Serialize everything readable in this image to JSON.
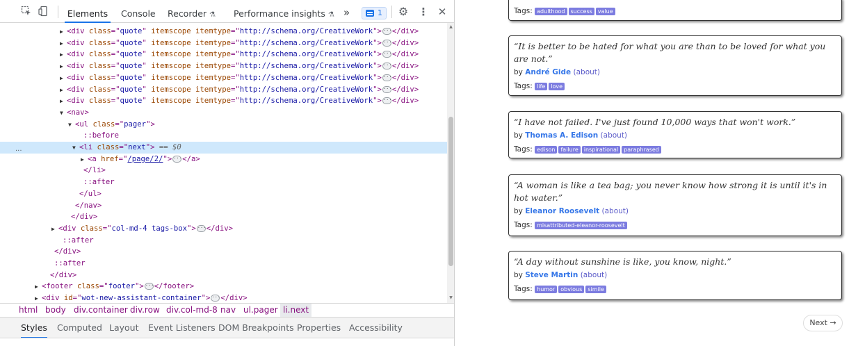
{
  "devtools": {
    "toolbar": {
      "tabs": [
        {
          "label": "Elements",
          "active": true
        },
        {
          "label": "Console",
          "active": false
        },
        {
          "label": "Recorder",
          "active": false
        },
        {
          "label": "Performance insights",
          "active": false
        }
      ],
      "more_tabs": "»",
      "issues_count": "1",
      "icons": [
        "inspect-icon",
        "device-toggle-icon",
        "flask-icon",
        "chevron-double-right-icon",
        "issues-icon",
        "gear-icon",
        "kebab-menu-icon",
        "close-icon"
      ]
    },
    "dom_lines": [
      {
        "indent": 0,
        "arrow": "▶",
        "parts": [
          [
            "tag",
            "<div "
          ],
          [
            "attr",
            "class"
          ],
          [
            "tag",
            "=\""
          ],
          [
            "val",
            "quote"
          ],
          [
            "tag",
            "\" "
          ],
          [
            "attr",
            "itemscope itemtype"
          ],
          [
            "tag",
            "=\""
          ],
          [
            "val",
            "http://schema.org/CreativeWork"
          ],
          [
            "tag",
            "\">"
          ],
          [
            "ell",
            ""
          ],
          [
            "tag",
            "</div>"
          ]
        ]
      },
      {
        "indent": 0,
        "arrow": "▶",
        "parts": [
          [
            "tag",
            "<div "
          ],
          [
            "attr",
            "class"
          ],
          [
            "tag",
            "=\""
          ],
          [
            "val",
            "quote"
          ],
          [
            "tag",
            "\" "
          ],
          [
            "attr",
            "itemscope itemtype"
          ],
          [
            "tag",
            "=\""
          ],
          [
            "val",
            "http://schema.org/CreativeWork"
          ],
          [
            "tag",
            "\">"
          ],
          [
            "ell",
            ""
          ],
          [
            "tag",
            "</div>"
          ]
        ]
      },
      {
        "indent": 0,
        "arrow": "▶",
        "parts": [
          [
            "tag",
            "<div "
          ],
          [
            "attr",
            "class"
          ],
          [
            "tag",
            "=\""
          ],
          [
            "val",
            "quote"
          ],
          [
            "tag",
            "\" "
          ],
          [
            "attr",
            "itemscope itemtype"
          ],
          [
            "tag",
            "=\""
          ],
          [
            "val",
            "http://schema.org/CreativeWork"
          ],
          [
            "tag",
            "\">"
          ],
          [
            "ell",
            ""
          ],
          [
            "tag",
            "</div>"
          ]
        ]
      },
      {
        "indent": 0,
        "arrow": "▶",
        "parts": [
          [
            "tag",
            "<div "
          ],
          [
            "attr",
            "class"
          ],
          [
            "tag",
            "=\""
          ],
          [
            "val",
            "quote"
          ],
          [
            "tag",
            "\" "
          ],
          [
            "attr",
            "itemscope itemtype"
          ],
          [
            "tag",
            "=\""
          ],
          [
            "val",
            "http://schema.org/CreativeWork"
          ],
          [
            "tag",
            "\">"
          ],
          [
            "ell",
            ""
          ],
          [
            "tag",
            "</div>"
          ]
        ]
      },
      {
        "indent": 0,
        "arrow": "▶",
        "parts": [
          [
            "tag",
            "<div "
          ],
          [
            "attr",
            "class"
          ],
          [
            "tag",
            "=\""
          ],
          [
            "val",
            "quote"
          ],
          [
            "tag",
            "\" "
          ],
          [
            "attr",
            "itemscope itemtype"
          ],
          [
            "tag",
            "=\""
          ],
          [
            "val",
            "http://schema.org/CreativeWork"
          ],
          [
            "tag",
            "\">"
          ],
          [
            "ell",
            ""
          ],
          [
            "tag",
            "</div>"
          ]
        ]
      },
      {
        "indent": 0,
        "arrow": "▶",
        "parts": [
          [
            "tag",
            "<div "
          ],
          [
            "attr",
            "class"
          ],
          [
            "tag",
            "=\""
          ],
          [
            "val",
            "quote"
          ],
          [
            "tag",
            "\" "
          ],
          [
            "attr",
            "itemscope itemtype"
          ],
          [
            "tag",
            "=\""
          ],
          [
            "val",
            "http://schema.org/CreativeWork"
          ],
          [
            "tag",
            "\">"
          ],
          [
            "ell",
            ""
          ],
          [
            "tag",
            "</div>"
          ]
        ]
      },
      {
        "indent": 0,
        "arrow": "▶",
        "parts": [
          [
            "tag",
            "<div "
          ],
          [
            "attr",
            "class"
          ],
          [
            "tag",
            "=\""
          ],
          [
            "val",
            "quote"
          ],
          [
            "tag",
            "\" "
          ],
          [
            "attr",
            "itemscope itemtype"
          ],
          [
            "tag",
            "=\""
          ],
          [
            "val",
            "http://schema.org/CreativeWork"
          ],
          [
            "tag",
            "\">"
          ],
          [
            "ell",
            ""
          ],
          [
            "tag",
            "</div>"
          ]
        ]
      },
      {
        "indent": 0,
        "arrow": "▼",
        "parts": [
          [
            "tag",
            "<nav>"
          ]
        ]
      },
      {
        "indent": 1,
        "arrow": "▼",
        "parts": [
          [
            "tag",
            "<ul "
          ],
          [
            "attr",
            "class"
          ],
          [
            "tag",
            "=\""
          ],
          [
            "val",
            "pager"
          ],
          [
            "tag",
            "\">"
          ]
        ]
      },
      {
        "indent": 2,
        "arrow": "",
        "parts": [
          [
            "pseudo",
            "::before"
          ]
        ]
      },
      {
        "indent": 1.5,
        "arrow": "▼",
        "selected": true,
        "parts": [
          [
            "tag",
            "<li "
          ],
          [
            "attr",
            "class"
          ],
          [
            "tag",
            "=\""
          ],
          [
            "val",
            "next"
          ],
          [
            "tag",
            "\">"
          ],
          [
            "eq",
            " == $0"
          ]
        ]
      },
      {
        "indent": 2.5,
        "arrow": "▶",
        "parts": [
          [
            "tag",
            "<a "
          ],
          [
            "attr",
            "href"
          ],
          [
            "tag",
            "=\""
          ],
          [
            "link",
            "/page/2/"
          ],
          [
            "tag",
            "\">"
          ],
          [
            "ell",
            ""
          ],
          [
            "tag",
            "</a>"
          ]
        ]
      },
      {
        "indent": 2,
        "arrow": "",
        "parts": [
          [
            "tag",
            "</li>"
          ]
        ]
      },
      {
        "indent": 2,
        "arrow": "",
        "parts": [
          [
            "pseudo",
            "::after"
          ]
        ]
      },
      {
        "indent": 1.5,
        "arrow": "",
        "parts": [
          [
            "tag",
            "</ul>"
          ]
        ]
      },
      {
        "indent": 1,
        "arrow": "",
        "parts": [
          [
            "tag",
            "</nav>"
          ]
        ]
      },
      {
        "indent": 0.5,
        "arrow": "",
        "parts": [
          [
            "tag",
            "</div>"
          ]
        ]
      },
      {
        "indent": -1,
        "arrow": "▶",
        "parts": [
          [
            "tag",
            "<div "
          ],
          [
            "attr",
            "class"
          ],
          [
            "tag",
            "=\""
          ],
          [
            "val",
            "col-md-4 tags-box"
          ],
          [
            "tag",
            "\">"
          ],
          [
            "ell",
            ""
          ],
          [
            "tag",
            "</div>"
          ]
        ]
      },
      {
        "indent": -0.5,
        "arrow": "",
        "parts": [
          [
            "pseudo",
            "::after"
          ]
        ]
      },
      {
        "indent": -1.5,
        "arrow": "",
        "parts": [
          [
            "tag",
            "</div>"
          ]
        ]
      },
      {
        "indent": -1.5,
        "arrow": "",
        "parts": [
          [
            "pseudo",
            "::after"
          ]
        ]
      },
      {
        "indent": -2,
        "arrow": "",
        "parts": [
          [
            "tag",
            "</div>"
          ]
        ]
      },
      {
        "indent": -3,
        "arrow": "▶",
        "parts": [
          [
            "tag",
            "<footer "
          ],
          [
            "attr",
            "class"
          ],
          [
            "tag",
            "=\""
          ],
          [
            "val",
            "footer"
          ],
          [
            "tag",
            "\">"
          ],
          [
            "ell",
            ""
          ],
          [
            "tag",
            "</footer>"
          ]
        ]
      },
      {
        "indent": -3,
        "arrow": "▶",
        "parts": [
          [
            "tag",
            "<div "
          ],
          [
            "attr",
            "id"
          ],
          [
            "tag",
            "=\""
          ],
          [
            "val",
            "wot-new-assistant-container"
          ],
          [
            "tag",
            "\">"
          ],
          [
            "ell",
            ""
          ],
          [
            "tag",
            "</div>"
          ]
        ]
      }
    ],
    "gutter_dots": "...",
    "breadcrumbs": [
      "html",
      "body",
      "div.container",
      "div.row",
      "div.col-md-8",
      "nav",
      "ul.pager",
      "li.next"
    ],
    "active_breadcrumb": "li.next",
    "sub_tabs": [
      "Styles",
      "Computed",
      "Layout",
      "Event Listeners",
      "DOM Breakpoints",
      "Properties",
      "Accessibility"
    ],
    "active_sub_tab": "Styles"
  },
  "page": {
    "top_partial_tags": [
      "adulthood",
      "success",
      "value"
    ],
    "quotes": [
      {
        "text": "“It is better to be hated for what you are than to be loved for what you are not.”",
        "author": "André Gide",
        "about": "(about)",
        "tags": [
          "life",
          "love"
        ]
      },
      {
        "text": "“I have not failed. I've just found 10,000 ways that won't work.”",
        "author": "Thomas A. Edison",
        "about": "(about)",
        "tags": [
          "edison",
          "failure",
          "inspirational",
          "paraphrased"
        ]
      },
      {
        "text": "“A woman is like a tea bag; you never know how strong it is until it's in hot water.”",
        "author": "Eleanor Roosevelt",
        "about": "(about)",
        "tags": [
          "misattributed-eleanor-roosevelt"
        ]
      },
      {
        "text": "“A day without sunshine is like, you know, night.”",
        "author": "Steve Martin",
        "about": "(about)",
        "tags": [
          "humor",
          "obvious",
          "simile"
        ]
      }
    ],
    "by_label": "by",
    "tags_label": "Tags:",
    "next_button": "Next →"
  }
}
